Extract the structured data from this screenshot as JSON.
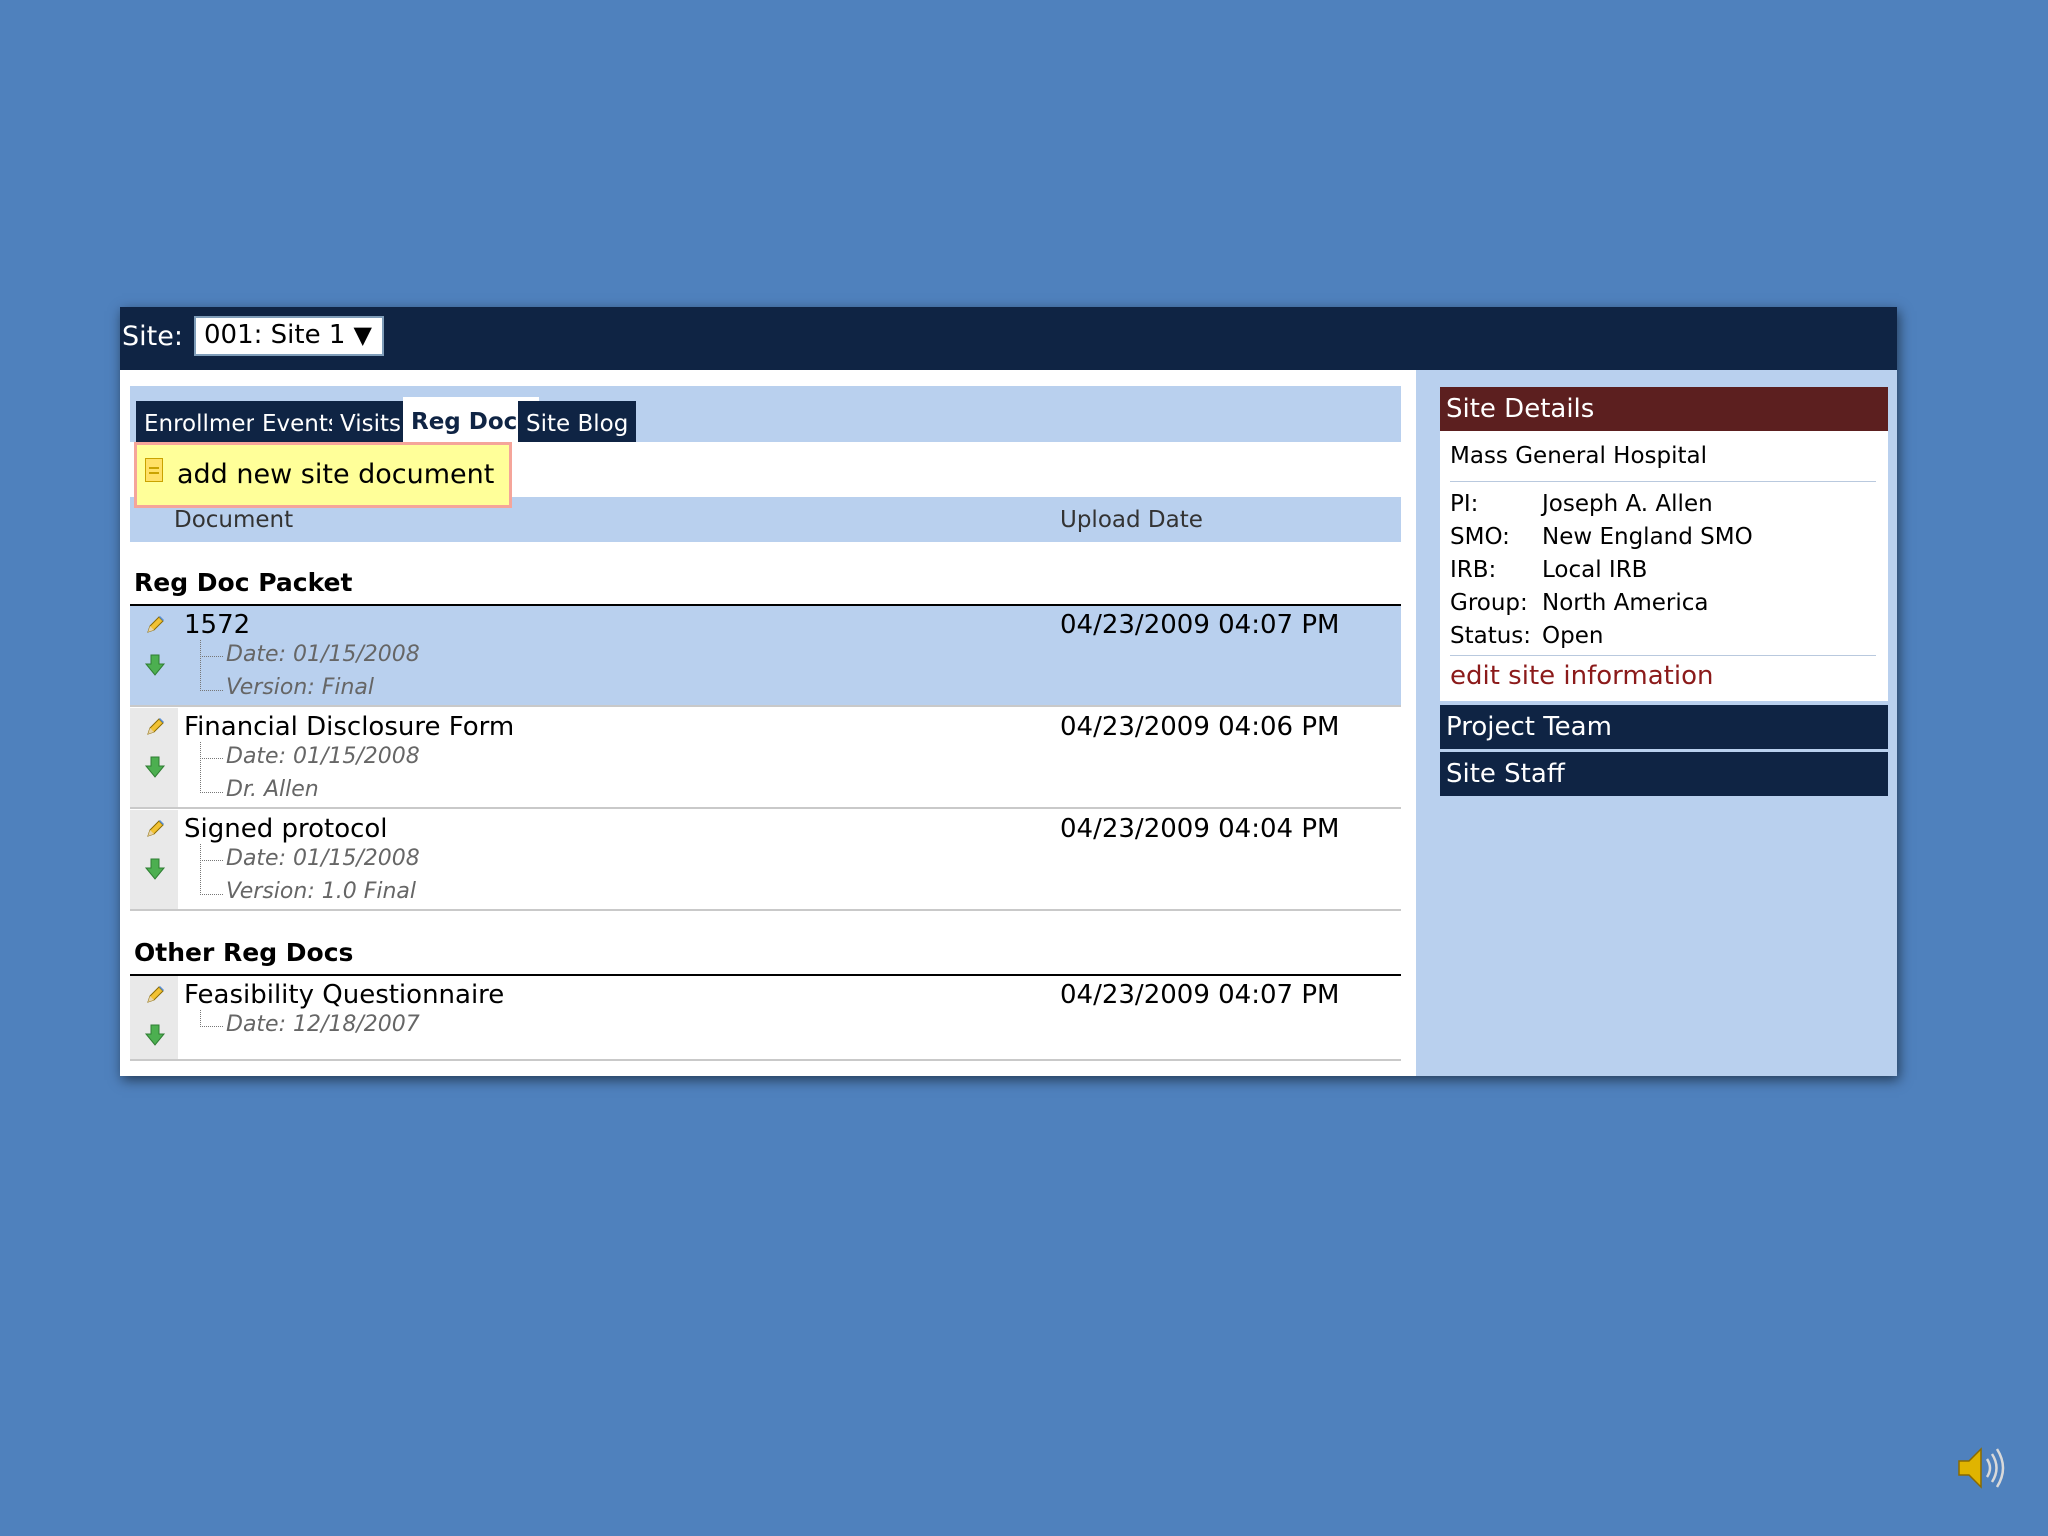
{
  "site_selector": {
    "label": "Site:",
    "value": "001: Site 1",
    "arrow": "▼"
  },
  "tabs": [
    {
      "label": "Enrollment"
    },
    {
      "label": "Events"
    },
    {
      "label": "Visits"
    },
    {
      "label": "Reg Docs",
      "active": true
    },
    {
      "label": "Site Blog"
    }
  ],
  "add_document": {
    "label": "add new site document",
    "icon": "document-icon"
  },
  "columns": {
    "document": "Document",
    "upload_date": "Upload Date"
  },
  "sections": [
    {
      "title": "Reg Doc Packet",
      "rows": [
        {
          "title": "1572",
          "upload_date": "04/23/2009 04:07 PM",
          "meta": [
            "Date: 01/15/2008",
            "Version: Final"
          ],
          "highlight": true
        },
        {
          "title": "Financial Disclosure Form",
          "upload_date": "04/23/2009 04:06 PM",
          "meta": [
            "Date: 01/15/2008",
            "Dr. Allen"
          ]
        },
        {
          "title": "Signed protocol",
          "upload_date": "04/23/2009 04:04 PM",
          "meta": [
            "Date: 01/15/2008",
            "Version: 1.0 Final"
          ]
        }
      ]
    },
    {
      "title": "Other Reg Docs",
      "rows": [
        {
          "title": "Feasibility Questionnaire",
          "upload_date": "04/23/2009 04:07 PM",
          "meta": [
            "Date: 12/18/2007"
          ]
        }
      ]
    }
  ],
  "site_details": {
    "header": "Site Details",
    "hospital": "Mass General Hospital",
    "fields": [
      {
        "key": "PI:",
        "value": "Joseph A. Allen"
      },
      {
        "key": "SMO:",
        "value": "New England SMO"
      },
      {
        "key": "IRB:",
        "value": "Local IRB"
      },
      {
        "key": "Group:",
        "value": "North America"
      },
      {
        "key": "Status:",
        "value": "Open"
      }
    ],
    "edit_link": "edit site information"
  },
  "side_panels": [
    {
      "label": "Project Team"
    },
    {
      "label": "Site Staff"
    }
  ],
  "colors": {
    "background": "#4f81bd",
    "navy": "#0f2444",
    "light_blue": "#b9d0ee",
    "maroon": "#5c1f1f",
    "highlight_yellow": "#ffff99"
  }
}
